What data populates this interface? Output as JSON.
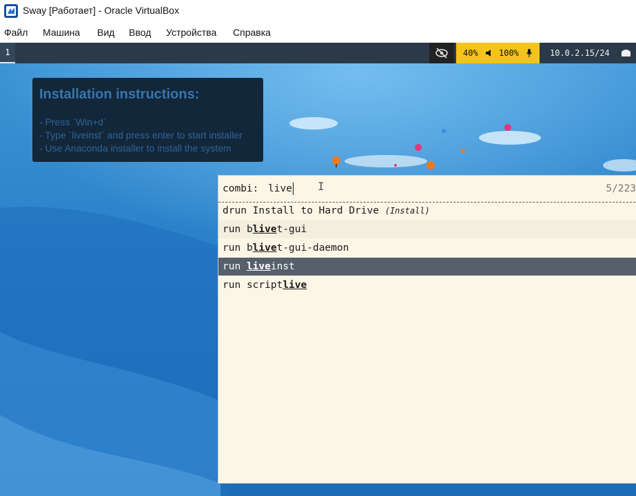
{
  "window": {
    "title": "Sway [Работает] - Oracle VirtualBox"
  },
  "menu": {
    "items": [
      "Файл",
      "Машина",
      "Вид",
      "Ввод",
      "Устройства",
      "Справка"
    ]
  },
  "swaybar": {
    "workspace": "1",
    "idle_inhibitor_icon": "eye-slash-icon",
    "volume": "40%",
    "volume_icon": "speaker-icon",
    "mic": "100%",
    "mic_icon": "microphone-icon",
    "network": "10.0.2.15/24",
    "network_icon": "ethernet-icon",
    "audio_color": "#f3c41b",
    "bar_color": "#2b3a4a"
  },
  "instructions": {
    "title": "Installation instructions:",
    "lines": [
      "- Press `Win+d`",
      "- Type `liveinst` and press enter to start installer",
      "- Use Anaconda installer to install the system"
    ]
  },
  "launcher": {
    "prompt": "combi:",
    "input_value": "live",
    "counter": "5/223",
    "entries": [
      {
        "mode": "drun",
        "pre": "Install to Hard Drive ",
        "comment": "(Install)"
      },
      {
        "mode": "run",
        "pre": "b",
        "match": "live",
        "post": "t-gui"
      },
      {
        "mode": "run",
        "pre": "b",
        "match": "live",
        "post": "t-gui-daemon"
      },
      {
        "mode": "run",
        "pre": "",
        "match": "live",
        "post": "inst"
      },
      {
        "mode": "run",
        "pre": "script",
        "match": "live",
        "post": ""
      }
    ],
    "selected_index": 3,
    "bg_color": "#fcf6e7",
    "selected_color": "#56606b"
  }
}
